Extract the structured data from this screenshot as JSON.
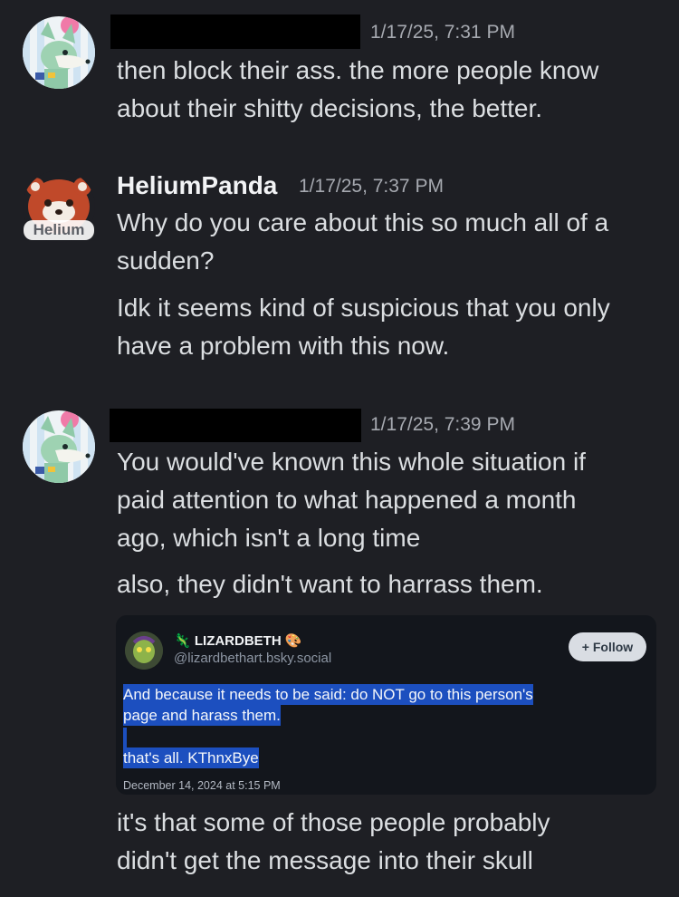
{
  "messages": [
    {
      "timestamp": "1/17/25, 7:31 PM",
      "lines": [
        "then block their ass. the more people know",
        "about their shitty decisions, the better."
      ]
    },
    {
      "username": "HeliumPanda",
      "avatar_label": "Helium",
      "timestamp": "1/17/25, 7:37 PM",
      "lines": [
        "Why do you care about this so much all of a",
        "sudden?",
        "Idk it seems kind of suspicious that you only",
        "have a problem with this now."
      ]
    },
    {
      "timestamp": "1/17/25, 7:39 PM",
      "lines": [
        "You would've known this whole situation if",
        "paid attention to what happened a month",
        "ago, which isn't a long time",
        "also, they didn't want to harrass them."
      ],
      "after_embed_lines": [
        "it's that some of those people probably",
        "didn't get the message into their skull"
      ]
    }
  ],
  "embed": {
    "display_name": "LIZARDBETH",
    "handle": "@lizardbethart.bsky.social",
    "follow_label": "+ Follow",
    "post_lines": [
      "And because it needs to be said: do NOT go to this person's",
      "page and harass them.",
      "that's all. KThnxBye"
    ],
    "date": "December 14, 2024 at 5:15 PM"
  },
  "colors": {
    "background": "#1e1f24",
    "text": "#dbdee1",
    "timestamp": "#a6a9b0",
    "highlight": "#1c4fbf"
  }
}
